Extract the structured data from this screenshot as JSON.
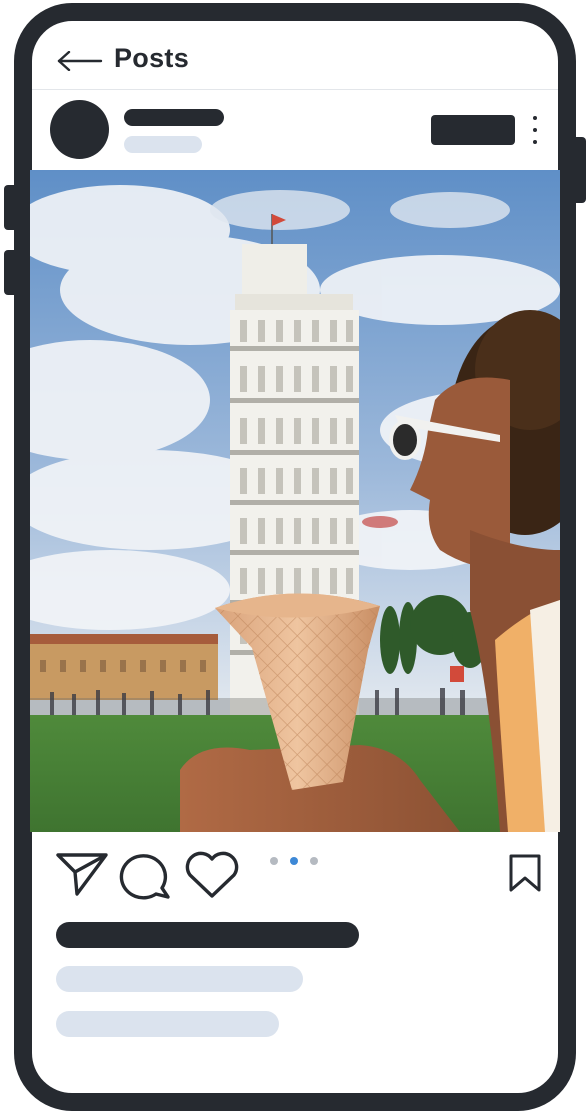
{
  "header": {
    "title": "Posts",
    "back_icon": "arrow-left-icon"
  },
  "post": {
    "more_icon": "vertical-dots-icon",
    "photo_description": "",
    "carousel": {
      "count": 3,
      "active_index": 1
    },
    "actions": [
      "send-icon",
      "comment-icon",
      "heart-icon",
      "bookmark-icon"
    ]
  },
  "colors": {
    "frame": "#262a30",
    "placeholder_dark": "#262a30",
    "placeholder_light": "#dbe3ee",
    "carousel_active": "#3d88d6",
    "carousel_inactive": "#b5bac1",
    "divider": "#e3e6ea"
  }
}
